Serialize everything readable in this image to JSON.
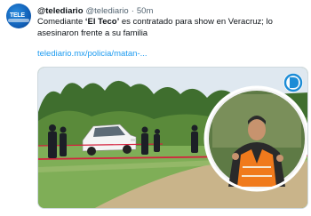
{
  "tweet": {
    "author": {
      "display_name": "@telediario",
      "handle": "@telediario",
      "avatar_text": "TELE",
      "avatar_icon": "telediario-logo-icon"
    },
    "separator": "·",
    "time": "50m",
    "text_before": "Comediante ",
    "text_bold": "‘El Teco’",
    "text_after": " es contratado para show en Veracruz; lo asesinaron frente a su familia",
    "link": "telediario.mx/policia/matan-...",
    "media": {
      "watermark_icon": "d-logo-icon",
      "colors": {
        "grass": "#7fae57",
        "sky": "#dfe8f0",
        "police_tape": "#d4213d",
        "vest": "#f07a1c"
      }
    }
  }
}
